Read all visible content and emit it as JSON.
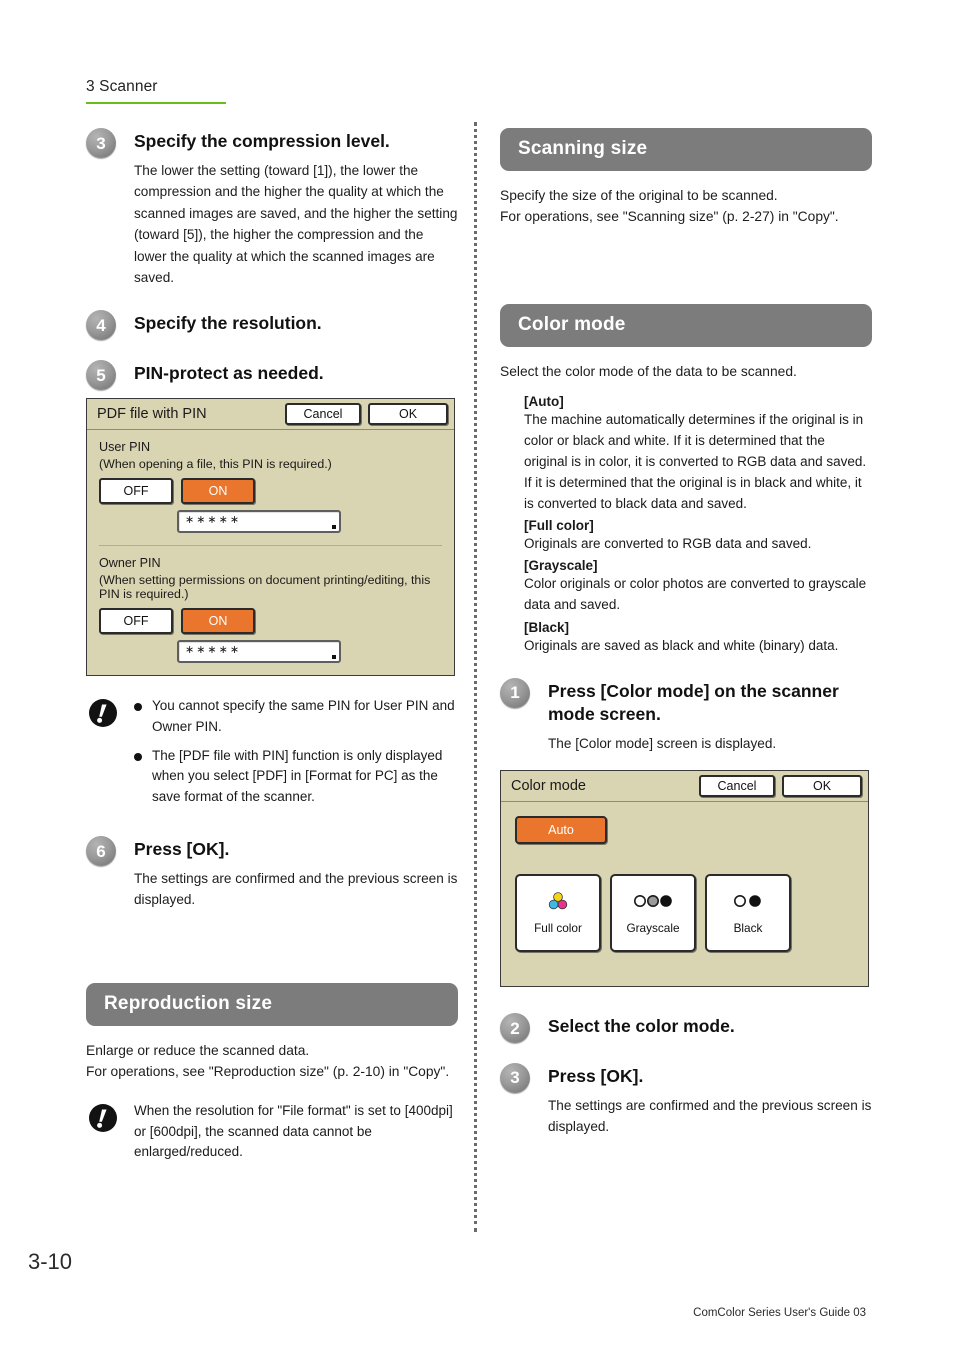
{
  "header": {
    "chapter": "3 Scanner",
    "rule_color": "#69bd18"
  },
  "footer": {
    "page_number": "3-10",
    "guide_note": "ComColor Series User's Guide 03"
  },
  "left_column": {
    "step3": {
      "number": "3",
      "title": "Specify the compression level.",
      "body": "The lower the setting (toward [1]), the lower the compression and the higher the quality at which the scanned images are saved, and the higher the setting (toward [5]), the higher the compression and the lower the quality at which the scanned images are saved."
    },
    "step4": {
      "number": "4",
      "title": "Specify the resolution."
    },
    "step5": {
      "number": "5",
      "title": "PIN-protect as needed."
    },
    "pin_dialog": {
      "title": "PDF file with PIN",
      "cancel_label": "Cancel",
      "ok_label": "OK",
      "user_pin_label": "User PIN",
      "user_pin_hint": "(When opening a file, this PIN is required.)",
      "owner_pin_label": "Owner PIN",
      "owner_pin_hint": "(When setting permissions on document printing/editing, this PIN is required.)",
      "off_label": "OFF",
      "on_label": "ON",
      "user_pin_value": "∗∗∗∗∗",
      "owner_pin_value": "∗∗∗∗∗",
      "selected_user": "ON",
      "selected_owner": "ON",
      "bg_color": "#d9d4b2",
      "accent_color": "#e9762c"
    },
    "pin_note": {
      "items": [
        "You cannot specify the same PIN for User PIN and Owner PIN.",
        "The [PDF file with PIN] function is only displayed when you select [PDF] in [Format for PC] as the save format of the scanner."
      ]
    },
    "step6": {
      "number": "6",
      "title": "Press [OK].",
      "body": "The settings are confirmed and the previous screen is displayed."
    },
    "reproduction_section": {
      "heading": "Reproduction size",
      "text": "Enlarge or reduce the scanned data.\nFor operations, see \"Reproduction size\" (p. 2-10) in \"Copy\".",
      "note": "When the resolution for \"File format\" is set to [400dpi] or [600dpi], the scanned data cannot be enlarged/reduced."
    }
  },
  "right_column": {
    "scanning_section": {
      "heading": "Scanning size",
      "text": "Specify the size of the original to be scanned.\nFor operations, see \"Scanning size\" (p. 2-27) in \"Copy\"."
    },
    "color_section": {
      "heading": "Color mode",
      "text": "Select the color mode of the data to be scanned.",
      "definitions": [
        {
          "term": "[Auto]",
          "desc": "The machine automatically determines if the original is in color or black and white. If it is determined that the original is in color, it is converted to RGB data and saved. If it is determined that the original is in black and white, it is converted to black data and saved."
        },
        {
          "term": "[Full color]",
          "desc": "Originals are converted to RGB data and saved."
        },
        {
          "term": "[Grayscale]",
          "desc": "Color originals or color photos are converted to grayscale data and saved."
        },
        {
          "term": "[Black]",
          "desc": "Originals are saved as black and white (binary) data."
        }
      ]
    },
    "step1": {
      "number": "1",
      "title": "Press [Color mode] on the scanner mode screen.",
      "body": "The [Color mode] screen is displayed."
    },
    "color_dialog": {
      "title": "Color mode",
      "cancel_label": "Cancel",
      "ok_label": "OK",
      "auto_label": "Auto",
      "selected": "Auto",
      "tiles": [
        {
          "label": "Full color",
          "icon": "cmy-dots-icon"
        },
        {
          "label": "Grayscale",
          "icon": "grayscale-dots-icon"
        },
        {
          "label": "Black",
          "icon": "black-dots-icon"
        }
      ],
      "bg_color": "#d9d4b2",
      "accent_color": "#e9762c"
    },
    "step2": {
      "number": "2",
      "title": "Select the color mode."
    },
    "step3": {
      "number": "3",
      "title": "Press [OK].",
      "body": "The settings are confirmed and the previous screen is displayed."
    }
  }
}
